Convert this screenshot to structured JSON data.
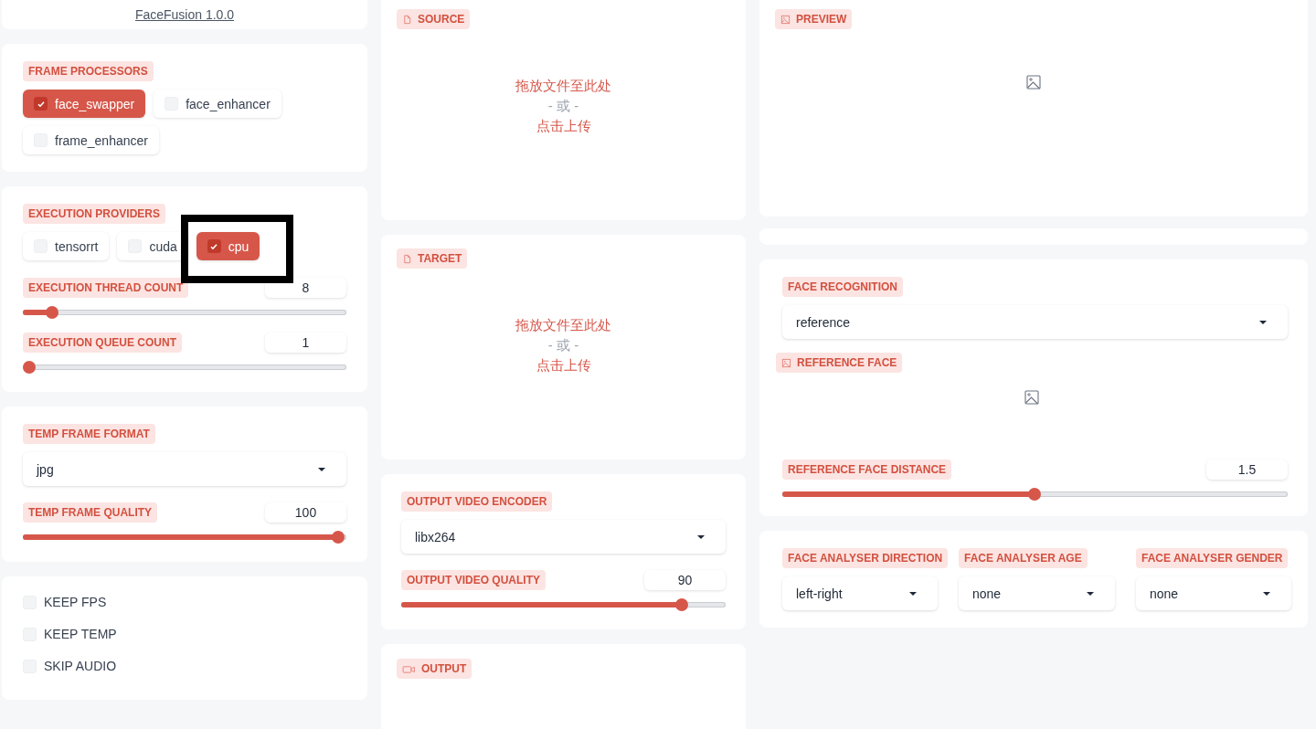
{
  "app_title": "FaceFusion 1.0.0",
  "frame_processors": {
    "label": "FRAME PROCESSORS",
    "options": [
      {
        "label": "face_swapper",
        "checked": true,
        "highlighted": false
      },
      {
        "label": "face_enhancer",
        "checked": false,
        "highlighted": false
      },
      {
        "label": "frame_enhancer",
        "checked": false,
        "highlighted": false
      }
    ]
  },
  "execution": {
    "providers": {
      "label": "EXECUTION PROVIDERS",
      "options": [
        {
          "label": "tensorrt",
          "checked": false,
          "highlighted": false
        },
        {
          "label": "cuda",
          "checked": false,
          "highlighted": false
        },
        {
          "label": "cpu",
          "checked": true,
          "highlighted": true
        }
      ]
    },
    "thread_count": {
      "label": "EXECUTION THREAD COUNT",
      "value": "8",
      "level": 0.075
    },
    "queue_count": {
      "label": "EXECUTION QUEUE COUNT",
      "value": "1",
      "level": 0
    }
  },
  "temp_frame": {
    "format": {
      "label": "TEMP FRAME FORMAT",
      "value": "jpg"
    },
    "quality": {
      "label": "TEMP FRAME QUALITY",
      "value": "100",
      "level": 1
    }
  },
  "toggles": [
    {
      "label": "KEEP FPS",
      "checked": false
    },
    {
      "label": "KEEP TEMP",
      "checked": false
    },
    {
      "label": "SKIP AUDIO",
      "checked": false
    }
  ],
  "source": {
    "label": "SOURCE",
    "kind": "file",
    "drop_text": "拖放文件至此处",
    "or_text": "- 或 -",
    "click_text": "点击上传"
  },
  "target": {
    "label": "TARGET",
    "kind": "file",
    "drop_text": "拖放文件至此处",
    "or_text": "- 或 -",
    "click_text": "点击上传"
  },
  "output_video": {
    "encoder": {
      "label": "OUTPUT VIDEO ENCODER",
      "value": "libx264"
    },
    "quality": {
      "label": "OUTPUT VIDEO QUALITY",
      "value": "90",
      "level": 0.885
    }
  },
  "output": {
    "label": "OUTPUT",
    "kind": "video"
  },
  "preview": {
    "label": "PREVIEW",
    "kind": "image"
  },
  "face_recognition": {
    "label": "FACE RECOGNITION",
    "value": "reference"
  },
  "reference_face": {
    "label": "REFERENCE FACE",
    "kind": "image"
  },
  "reference_face_distance": {
    "label": "REFERENCE FACE DISTANCE",
    "value": "1.5",
    "level": 0.5
  },
  "face_analyser": [
    {
      "label": "FACE ANALYSER DIRECTION",
      "value": "left-right"
    },
    {
      "label": "FACE ANALYSER AGE",
      "value": "none"
    },
    {
      "label": "FACE ANALYSER GENDER",
      "value": "none"
    }
  ]
}
